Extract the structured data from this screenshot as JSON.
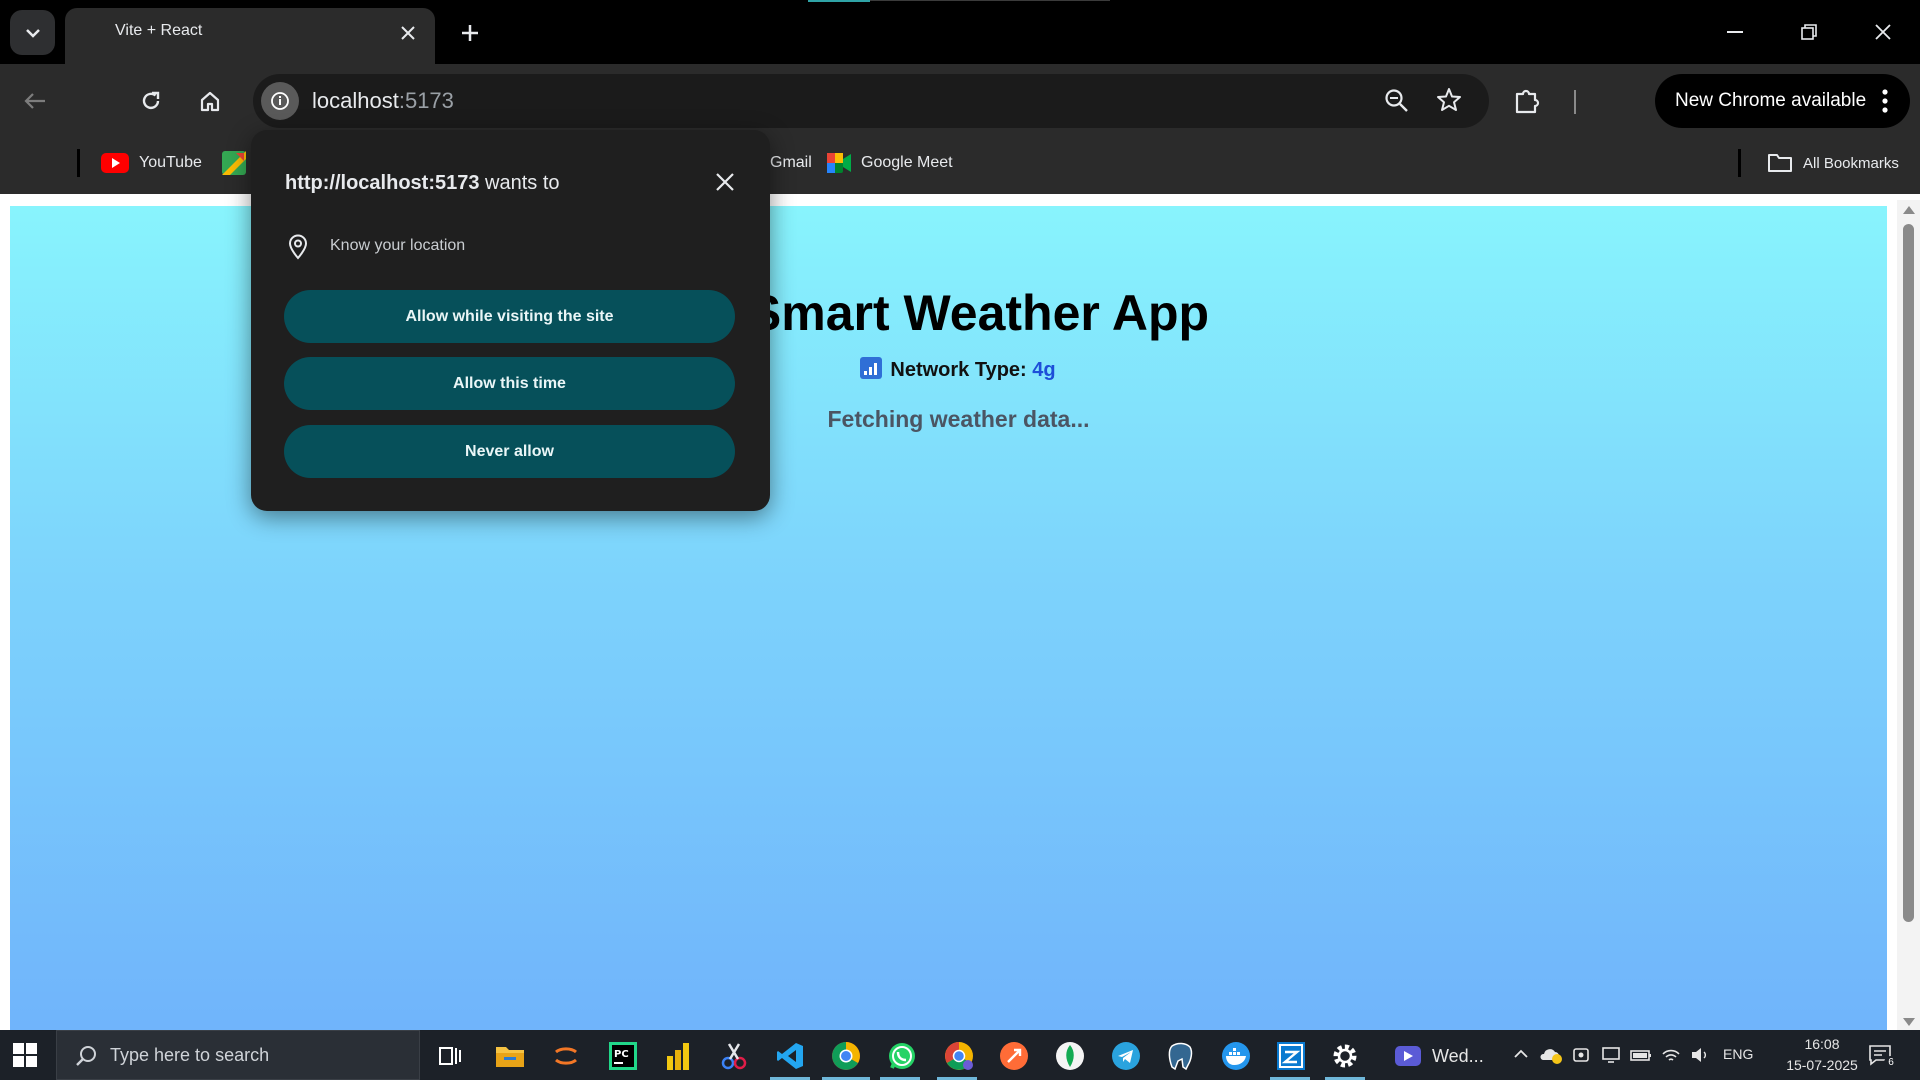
{
  "tab": {
    "title": "Vite + React"
  },
  "omnibox": {
    "host": "localhost",
    "port": ":5173"
  },
  "update": {
    "label": "New Chrome available"
  },
  "bookmarks": [
    {
      "label": "YouTube"
    },
    {
      "label": "Gmail"
    },
    {
      "label": "Google Meet"
    }
  ],
  "all_bookmarks": "All Bookmarks",
  "page": {
    "title": "Smart Weather App",
    "network_label": "Network Type:",
    "network_value": "4g",
    "status": "Fetching weather data..."
  },
  "permission": {
    "origin": "http://localhost:5173",
    "wants_to": " wants to",
    "capability": "Know your location",
    "allow_visit": "Allow while visiting the site",
    "allow_once": "Allow this time",
    "never": "Never allow"
  },
  "taskbar": {
    "search_placeholder": "Type here to search",
    "zoom_label": "Wed...",
    "lang": "ENG",
    "time": "16:08",
    "date": "15-07-2025",
    "notifications": "6"
  },
  "colors": {
    "accent": "#06505a",
    "page_gradient_top": "#88f4fd",
    "page_gradient_bottom": "#70b4fb",
    "network_value": "#1d4ed8"
  }
}
